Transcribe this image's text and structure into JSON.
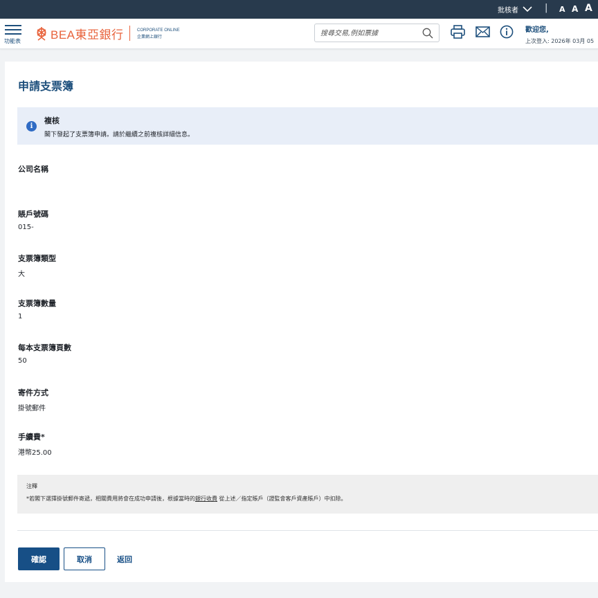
{
  "topbar": {
    "role_label": "批核者",
    "separator": "|",
    "font_sizes": [
      "A",
      "A",
      "A"
    ]
  },
  "header": {
    "menu_label": "功能表",
    "logo_text": "BEA東亞銀行",
    "corp_line1": "CORPORATE ONLINE",
    "corp_line2": "企業網上銀行",
    "search_placeholder": "搜尋交易,例如票據",
    "welcome": "歡迎您,",
    "last_login": "上次登入: 2026年 03月 05"
  },
  "page": {
    "title": "申請支票簿",
    "notice_title": "複核",
    "notice_message": "閣下發起了支票簿申請。請於繼續之前複核詳細信息。",
    "fields": [
      {
        "label": "公司名稱",
        "value": ""
      },
      {
        "label": "賬戶號碼",
        "value": "015-"
      },
      {
        "label": "支票簿類型",
        "value": "大"
      },
      {
        "label": "支票簿數量",
        "value": "1"
      },
      {
        "label": "每本支票簿頁數",
        "value": "50"
      },
      {
        "label": "寄件方式",
        "value": "掛號郵件"
      },
      {
        "label": "手續費*",
        "value": "港幣25.00"
      }
    ],
    "note_title": "注釋",
    "note_text_before": "*若閣下選擇掛號郵件寄遞，相關費用將會在成功申請後，根據當時的",
    "note_link": "銀行收費",
    "note_text_after": " 從上述／指定賬戶（證監會客戶資產賬戶）中扣除。",
    "confirm_label": "確認",
    "cancel_label": "取消",
    "back_label": "返回"
  },
  "colors": {
    "primary": "#174f86",
    "brand": "#e8633c",
    "topbar": "#283a4d",
    "notice_bg": "#e8eef8"
  }
}
